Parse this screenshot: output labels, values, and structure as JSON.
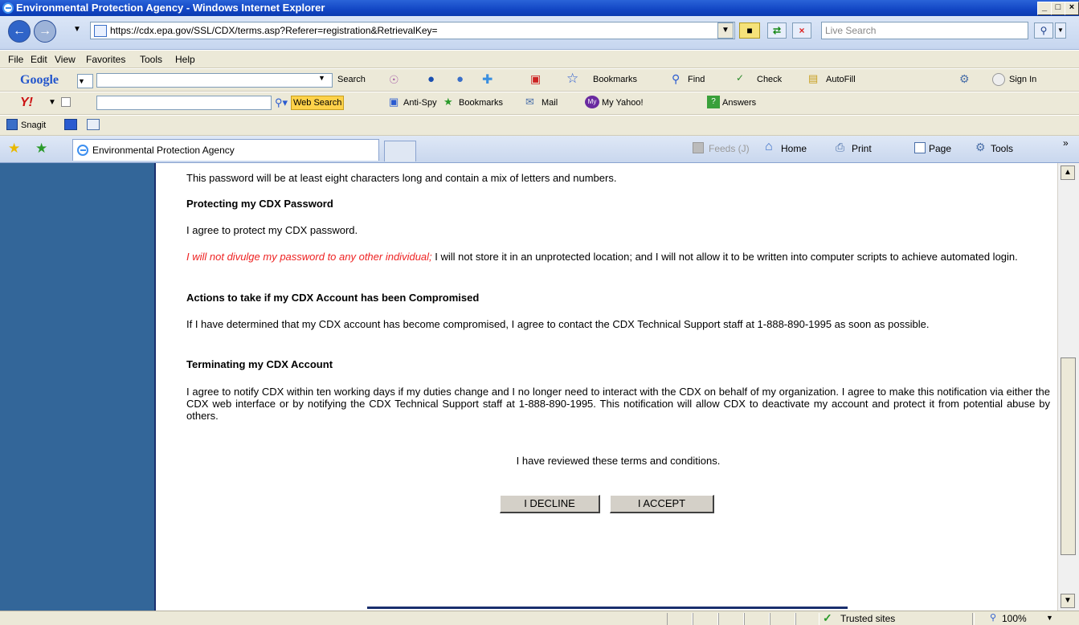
{
  "window": {
    "title": "Environmental Protection Agency - Windows Internet Explorer"
  },
  "address": {
    "url": "https://cdx.epa.gov/SSL/CDX/terms.asp?Referer=registration&RetrievalKey=",
    "search_placeholder": "Live Search"
  },
  "menu": [
    "File",
    "Edit",
    "View",
    "Favorites",
    "Tools",
    "Help"
  ],
  "google_toolbar": {
    "brand": "Google",
    "search_label": "Search",
    "bookmarks": "Bookmarks",
    "find": "Find",
    "check": "Check",
    "autofill": "AutoFill",
    "signin": "Sign In"
  },
  "yahoo_toolbar": {
    "web_search": "Web Search",
    "antispy": "Anti-Spy",
    "bookmarks": "Bookmarks",
    "mail": "Mail",
    "my_yahoo": "My Yahoo!",
    "answers": "Answers"
  },
  "snagit_toolbar": {
    "label": "Snagit"
  },
  "tab": {
    "title": "Environmental Protection Agency"
  },
  "command_bar": {
    "feeds": "Feeds (J)",
    "home": "Home",
    "print": "Print",
    "page": "Page",
    "tools": "Tools"
  },
  "content": {
    "p_password": "This password will be at least eight characters long and contain a mix of letters and numbers.",
    "h_protect": "Protecting my CDX Password",
    "p_protect": "I agree to protect my CDX password.",
    "p_divulge_red": "I will not divulge my password to any other individual;",
    "p_divulge_rest": " I will not store it in an unprotected location; and I will not allow it to be written into computer scripts to achieve automated login.",
    "h_compromised": "Actions to take if my CDX Account has been Compromised",
    "p_compromised": "If I have determined that my CDX account has become compromised, I agree to contact the CDX Technical Support staff at 1-888-890-1995 as soon as possible.",
    "h_terminate": "Terminating my CDX Account",
    "p_terminate": "I agree to notify CDX within ten working days if my duties change and I no longer need to interact with the CDX on behalf of my organization. I agree to make this notification via either the CDX web interface or by notifying the CDX Technical Support staff at 1-888-890-1995. This notification will allow CDX to deactivate my account and protect it from potential abuse by others.",
    "reviewed": "I have reviewed these terms and conditions.",
    "decline": "I DECLINE",
    "accept": "I ACCEPT"
  },
  "status": {
    "zone": "Trusted sites",
    "zoom": "100%"
  }
}
